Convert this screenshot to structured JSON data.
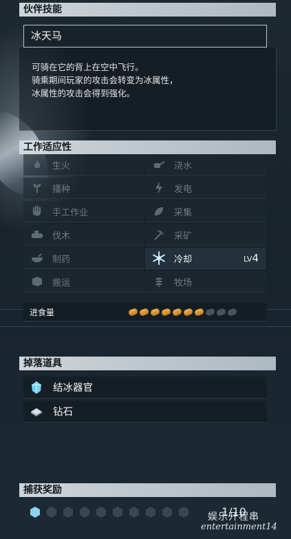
{
  "partner_skill": {
    "header": "伙伴技能",
    "name": "冰天马",
    "description": [
      "可骑在它的背上在空中飞行。",
      "骑乘期间玩家的攻击会转变为冰属性，",
      "冰属性的攻击会得到强化。"
    ]
  },
  "work_suitability": {
    "header": "工作适应性",
    "items": [
      {
        "label": "生火",
        "icon": "flame-icon",
        "active": false
      },
      {
        "label": "浇水",
        "icon": "watering-can-icon",
        "active": false
      },
      {
        "label": "播种",
        "icon": "sprout-icon",
        "active": false
      },
      {
        "label": "发电",
        "icon": "lightning-icon",
        "active": false
      },
      {
        "label": "手工作业",
        "icon": "hand-icon",
        "active": false
      },
      {
        "label": "采集",
        "icon": "leaf-icon",
        "active": false
      },
      {
        "label": "伐木",
        "icon": "log-icon",
        "active": false
      },
      {
        "label": "采矿",
        "icon": "pickaxe-icon",
        "active": false
      },
      {
        "label": "制药",
        "icon": "bowl-icon",
        "active": false
      },
      {
        "label": "冷却",
        "icon": "snowflake-icon",
        "active": true,
        "level_prefix": "LV",
        "level": "4"
      },
      {
        "label": "搬运",
        "icon": "box-icon",
        "active": false
      },
      {
        "label": "牧场",
        "icon": "wheat-icon",
        "active": false
      }
    ]
  },
  "food": {
    "label": "进食量",
    "filled": 7,
    "total": 10
  },
  "drops": {
    "header": "掉落道具",
    "items": [
      {
        "label": "结冰器官",
        "icon": "ice-organ-icon"
      },
      {
        "label": "钻石",
        "icon": "diamond-icon"
      }
    ]
  },
  "capture_reward": {
    "header": "捕获奖励",
    "current": 1,
    "total": 10,
    "counter_text": "1/10"
  },
  "watermark": {
    "line1": "娱乐开程串",
    "line2": "entertainment14"
  },
  "colors": {
    "accent_ice": "#8fd2f2",
    "food_full": "#e9a23b",
    "header_bg": "#d7dee3"
  }
}
